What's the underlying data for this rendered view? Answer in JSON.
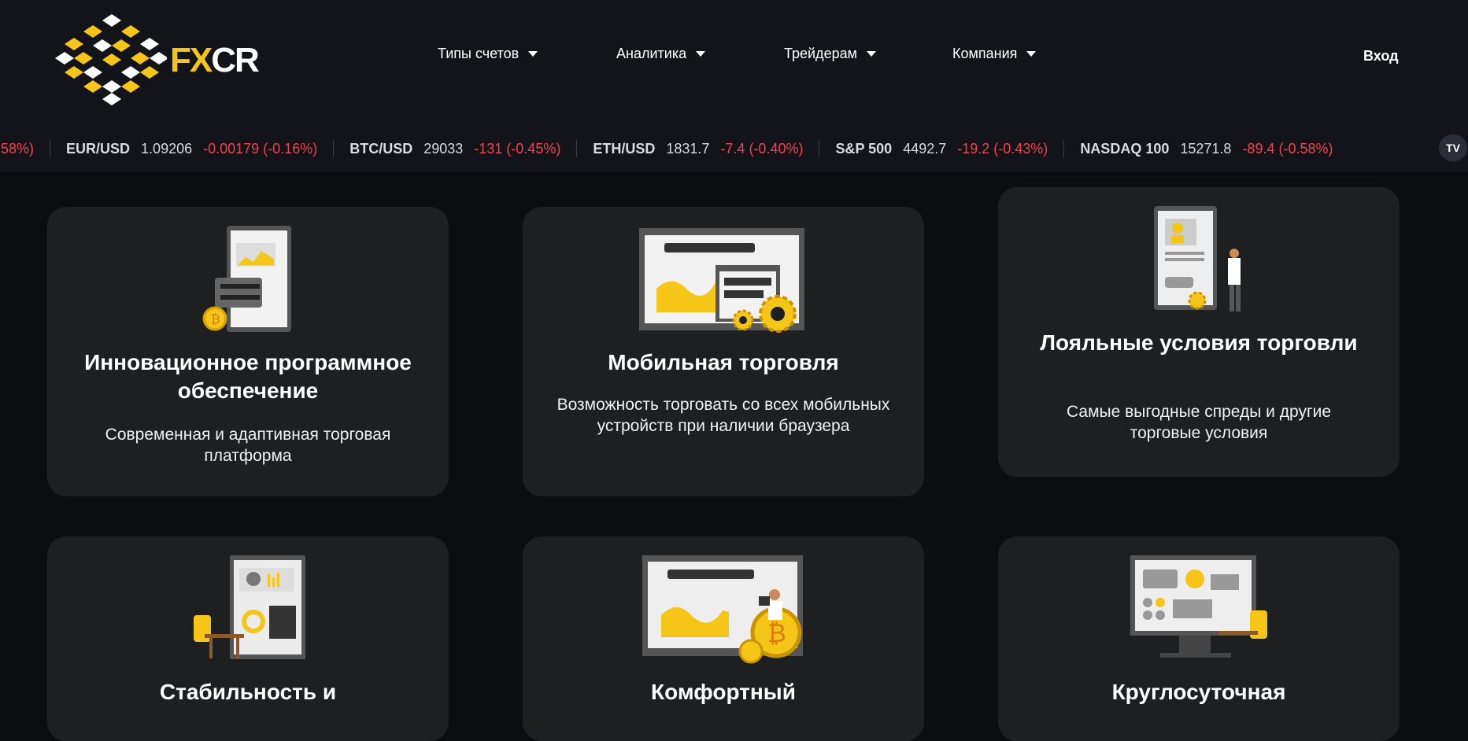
{
  "brand": {
    "logo_text_a": "FX",
    "logo_text_b": "CR"
  },
  "nav": [
    {
      "label": "Типы счетов"
    },
    {
      "label": "Аналитика"
    },
    {
      "label": "Трейдерам"
    },
    {
      "label": "Компания"
    }
  ],
  "login_label": "Вход",
  "ticker": [
    {
      "symbol": "",
      "price": "",
      "change": ".58%)"
    },
    {
      "symbol": "EUR/USD",
      "price": "1.09206",
      "change": "-0.00179 (-0.16%)"
    },
    {
      "symbol": "BTC/USD",
      "price": "29033",
      "change": "-131 (-0.45%)"
    },
    {
      "symbol": "ETH/USD",
      "price": "1831.7",
      "change": "-7.4 (-0.40%)"
    },
    {
      "symbol": "S&P 500",
      "price": "4492.7",
      "change": "-19.2 (-0.43%)"
    },
    {
      "symbol": "NASDAQ 100",
      "price": "15271.8",
      "change": "-89.4 (-0.58%)"
    }
  ],
  "tv_badge": "TV",
  "cards": [
    {
      "title": "Инновационное программное обеспечение",
      "text": "Современная и адаптивная торговая платформа"
    },
    {
      "title": "Мобильная торговля",
      "text": "Возможность торговать со всех мобильных устройств при наличии браузера"
    },
    {
      "title": "Лояльные условия торговли",
      "text": "Самые выгодные спреды и другие торговые условия"
    },
    {
      "title": "Стабильность и",
      "text": ""
    },
    {
      "title": "Комфортный",
      "text": ""
    },
    {
      "title": "Круглосуточная",
      "text": ""
    }
  ],
  "colors": {
    "accent": "#f5c518",
    "negative": "#f2414f",
    "card_bg": "#1e1f20",
    "header_bg": "#12141a"
  }
}
